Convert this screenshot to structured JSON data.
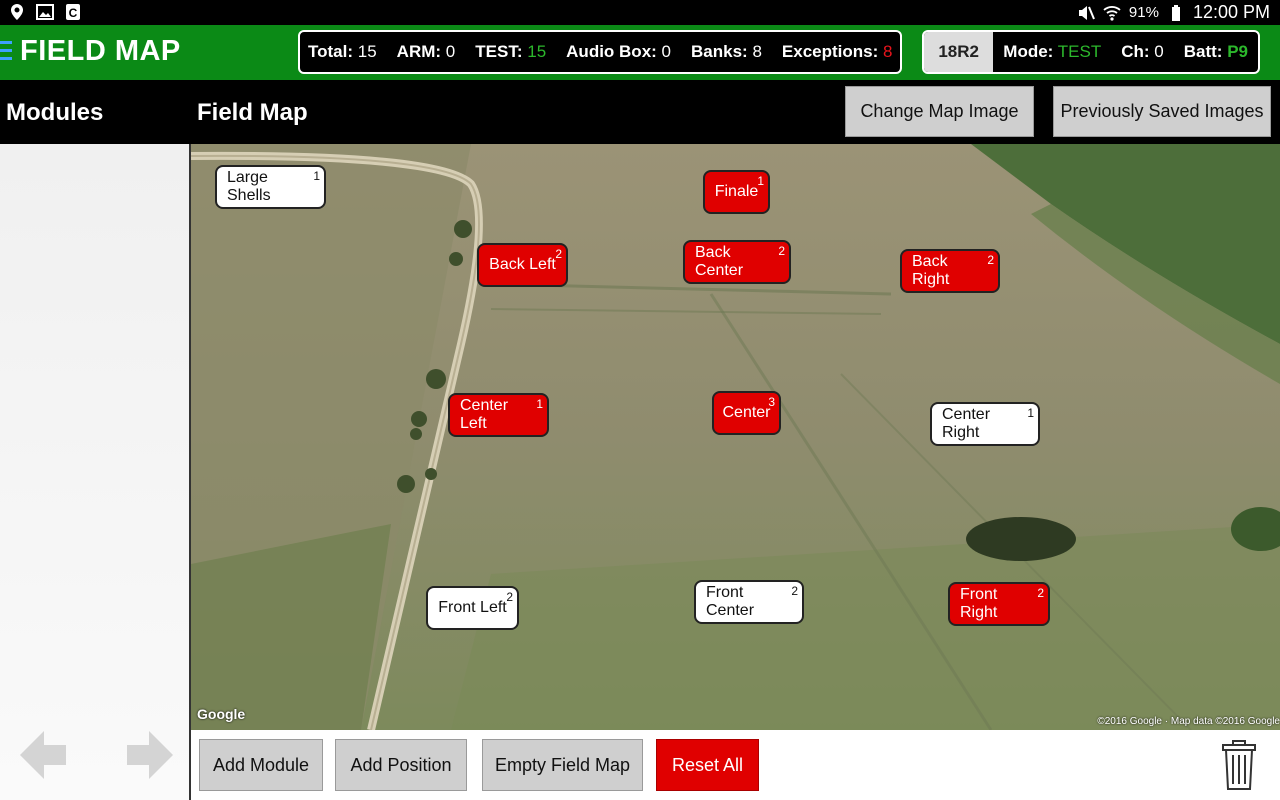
{
  "status_bar": {
    "time": "12:00 PM",
    "battery_pct": "91%",
    "left_icons": [
      "location-icon",
      "image-icon",
      "c-app-icon"
    ],
    "right_icons": [
      "mute-icon",
      "wifi-icon",
      "battery-icon"
    ]
  },
  "app_bar": {
    "title": "FIELD MAP",
    "stats": [
      {
        "label": "Total:",
        "value": "15",
        "color": "white"
      },
      {
        "label": "ARM:",
        "value": "0",
        "color": "white"
      },
      {
        "label": "TEST:",
        "value": "15",
        "color": "green"
      },
      {
        "label": "Audio Box:",
        "value": "0",
        "color": "white"
      },
      {
        "label": "Banks:",
        "value": "8",
        "color": "white"
      },
      {
        "label": "Exceptions:",
        "value": "8",
        "color": "red"
      }
    ],
    "device": {
      "id": "18R2",
      "mode_label": "Mode:",
      "mode_value": "TEST",
      "ch_label": "Ch:",
      "ch_value": "0",
      "batt_label": "Batt:",
      "batt_value": "P9"
    }
  },
  "header": {
    "modules_title": "Modules",
    "fieldmap_title": "Field Map",
    "change_map_button": "Change Map Image",
    "saved_images_button": "Previously Saved Images"
  },
  "map": {
    "google_label": "Google",
    "attribution": "©2016 Google · Map data ©2016 Google",
    "positions": [
      {
        "name": "Large Shells",
        "count": "1",
        "state": "white"
      },
      {
        "name": "Finale",
        "count": "1",
        "state": "red"
      },
      {
        "name": "Back Left",
        "count": "2",
        "state": "red"
      },
      {
        "name": "Back Center",
        "count": "2",
        "state": "red"
      },
      {
        "name": "Back Right",
        "count": "2",
        "state": "red"
      },
      {
        "name": "Center Left",
        "count": "1",
        "state": "red"
      },
      {
        "name": "Center",
        "count": "3",
        "state": "red"
      },
      {
        "name": "Center Right",
        "count": "1",
        "state": "white"
      },
      {
        "name": "Front Left",
        "count": "2",
        "state": "white"
      },
      {
        "name": "Front Center",
        "count": "2",
        "state": "white"
      },
      {
        "name": "Front Right",
        "count": "2",
        "state": "red"
      }
    ]
  },
  "bottom_bar": {
    "add_module": "Add Module",
    "add_position": "Add Position",
    "empty_field_map": "Empty Field Map",
    "reset_all": "Reset All"
  },
  "colors": {
    "app_bar": "#0b8a16",
    "armed_red": "#e00000",
    "test_green": "#2cb82c"
  }
}
